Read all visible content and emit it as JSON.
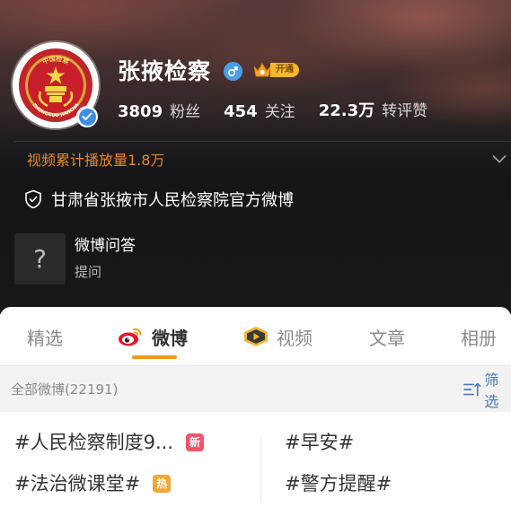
{
  "profile": {
    "name": "张掖检察",
    "vip_label": "开通",
    "avatar_emblem_top_text": "中国检察",
    "avatar_emblem_bottom_text": "ZHONGGUO JIANCHA",
    "stats": [
      {
        "value": "3809",
        "label": "粉丝"
      },
      {
        "value": "454",
        "label": "关注"
      },
      {
        "value": "22.3万",
        "label": "转评赞"
      }
    ],
    "video_plays": "视频累计播放量1.8万",
    "official_description": "甘肃省张掖市人民检察院官方微博",
    "qa": {
      "icon": "?",
      "title": "微博问答",
      "subtitle": "提问"
    }
  },
  "tabs": [
    {
      "label": "精选",
      "active": false
    },
    {
      "label": "微博",
      "active": true
    },
    {
      "label": "视频",
      "active": false
    },
    {
      "label": "文章",
      "active": false
    },
    {
      "label": "相册",
      "active": false
    }
  ],
  "filter": {
    "feed_count": "全部微博(22191)",
    "filter_label": "筛选"
  },
  "topics": [
    {
      "label": "#人民检察制度9...",
      "tag": "新"
    },
    {
      "label": "#早安#",
      "tag": ""
    },
    {
      "label": "#法治微课堂#",
      "tag": "热"
    },
    {
      "label": "#警方提醒#",
      "tag": ""
    }
  ],
  "colors": {
    "accent_orange": "#f39a1d",
    "video_plays_text": "#e4882c",
    "verified_blue": "#3d8ee6",
    "filter_blue": "#4a7bb5",
    "new_tag": "#f0546a",
    "hot_tag": "#f4a736"
  },
  "icons": {
    "gender": "male-icon",
    "verified": "verified-check-icon",
    "expand": "chevron-down-icon",
    "official": "shield-check-icon",
    "weibo_tab": "weibo-logo-icon",
    "video_tab": "video-play-icon",
    "filter": "filter-icon"
  }
}
